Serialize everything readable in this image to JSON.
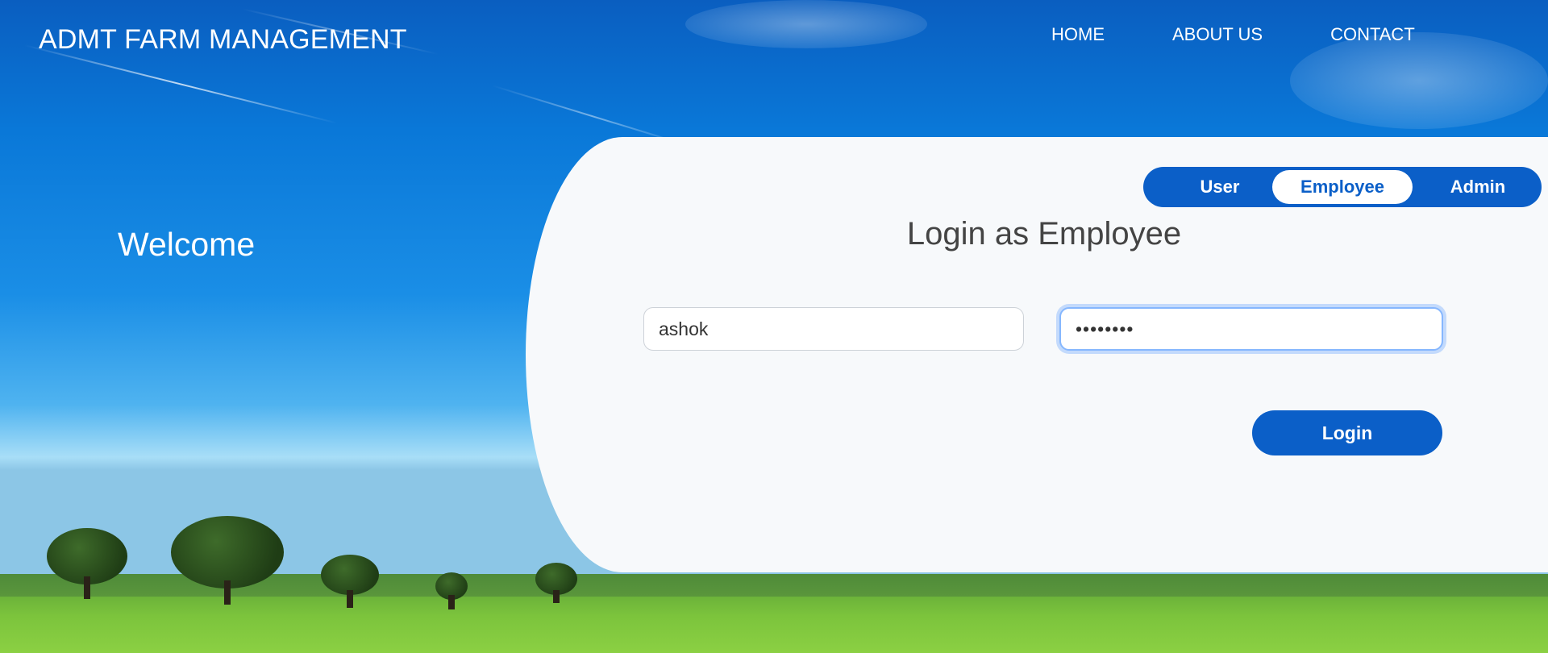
{
  "header": {
    "brand": "ADMT FARM MANAGEMENT",
    "nav": [
      "HOME",
      "ABOUT US",
      "CONTACT"
    ]
  },
  "hero": {
    "welcome": "Welcome"
  },
  "login": {
    "roles": [
      "User",
      "Employee",
      "Admin"
    ],
    "active_role": "Employee",
    "title": "Login as Employee",
    "username_value": "ashok",
    "password_value": "••••••••",
    "button_label": "Login"
  },
  "colors": {
    "accent": "#0b5fc8",
    "panel": "#f7f9fb",
    "focus_ring": "#86b7fe"
  }
}
